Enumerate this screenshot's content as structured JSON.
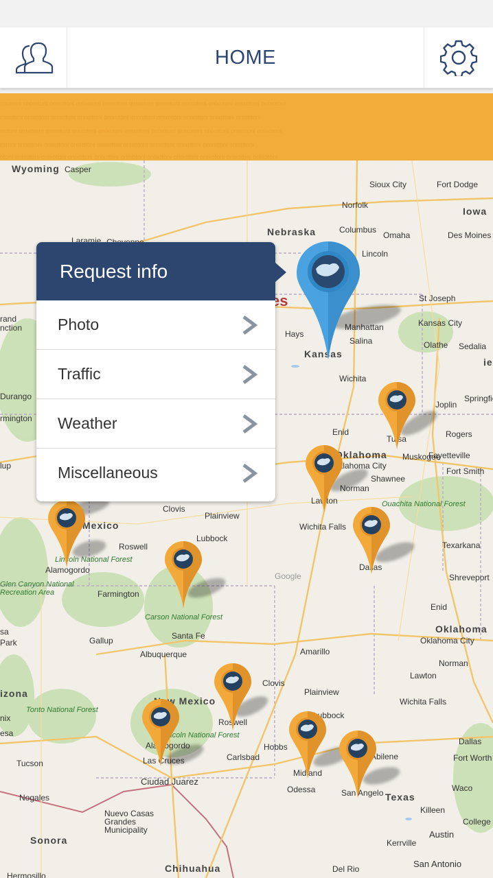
{
  "header": {
    "title": "HOME",
    "left_icon": "users-icon",
    "right_icon": "gear-icon"
  },
  "banner": {
    "color": "#f2ac3a",
    "pattern_text": "nixotoni"
  },
  "map": {
    "labels": {
      "wyoming": "Wyoming",
      "casper": "Casper",
      "nebraska": "Nebraska",
      "siouxcity": "Sioux City",
      "fortdodge": "Fort Dodge",
      "iowa": "Iowa",
      "norfolk": "Norfolk",
      "columbus": "Columbus",
      "omaha": "Omaha",
      "desmoines": "Des Moines",
      "lincoln": "Lincoln",
      "laramie": "Laramie",
      "cheyenne": "Cheyenne",
      "stjoseph": "St Joseph",
      "kansascity": "Kansas City",
      "manhattan": "Manhattan",
      "hays": "Hays",
      "salina": "Salina",
      "olathe": "Olathe",
      "sedalia": "Sedalia",
      "kansas": "Kansas",
      "wichita": "Wichita",
      "springfield": "Springfie",
      "joplin": "Joplin",
      "durango": "Durango",
      "farmington_top": "Farmington",
      "enid": "Enid",
      "tulsa": "Tulsa",
      "rogers": "Rogers",
      "oklahoma_top": "Oklahoma",
      "okcity_top": "Oklahoma City",
      "muskogee": "Muskogee",
      "fayetteville": "Fayetteville",
      "shawnee": "Shawnee",
      "fortsmith": "Fort Smith",
      "norman_top": "Norman",
      "lawton_top": "Lawton",
      "ouachita": "Ouachita National Forest",
      "clovis_top": "Clovis",
      "plainview_top": "Plainview",
      "mexico": "Mexico",
      "lubbock": "Lubbock",
      "wichitafalls": "Wichita Falls",
      "texarkana": "Texarkana",
      "roswell_top": "Roswell",
      "alamogordo_top": "Alamogordo",
      "lincolnforest_top": "Lincoln National Forest",
      "dallas_top": "Dallas",
      "shreveport": "Shreveport",
      "glencanyon": "Glen Canyon National Recreation Area",
      "farmington": "Farmington",
      "carson": "Carson National Forest",
      "enid2": "Enid",
      "oklahoma": "Oklahoma",
      "okcity": "Oklahoma City",
      "santafe": "Santa Fe",
      "gallup": "Gallup",
      "park": "Park",
      "amarillo": "Amarillo",
      "norman": "Norman",
      "albuquerque": "Albuquerque",
      "clovis": "Clovis",
      "lawton": "Lawton",
      "plainview": "Plainview",
      "wichitafalls2": "Wichita Falls",
      "arizona": "izona",
      "tonto": "Tonto National Forest",
      "newmexico": "New Mexico",
      "lubbock2": "Lubbock",
      "roswell": "Roswell",
      "nix": "nix",
      "esa": "esa",
      "lincolnforest": "Lincoln National Forest",
      "alamogordo": "Alamogordo",
      "hobbs": "Hobbs",
      "dallas": "Dallas",
      "fortworth": "Fort Worth",
      "tucson": "Tucson",
      "lascruces": "Las Cruces",
      "carlsbad": "Carlsbad",
      "midland": "Midland",
      "abilene": "Abilene",
      "ciudadjuarez": "Ciudad Juarez",
      "odessa": "Odessa",
      "waco": "Waco",
      "nogales": "Nogales",
      "sanangelo": "San Angelo",
      "texas": "Texas",
      "killeen": "Killeen",
      "nuevocasas": "Nuevo Casas Grandes Municipality",
      "collegestation": "College St",
      "sonora": "Sonora",
      "austin": "Austin",
      "kerrville": "Kerrville",
      "chihuahua": "Chihuahua",
      "sanantonio": "San Antonio",
      "hermosillo": "Hermosillo",
      "delrio": "Del Rio",
      "google": "Google",
      "states_fragment": "es",
      "grand": "rand",
      "unction": "nction",
      "rmington": "rmington",
      "lup": "lup",
      "sa": "sa",
      "ie": "ie"
    }
  },
  "popup": {
    "title": "Request info",
    "items": [
      {
        "label": "Photo"
      },
      {
        "label": "Traffic"
      },
      {
        "label": "Weather"
      },
      {
        "label": "Miscellaneous"
      }
    ]
  },
  "pins": {
    "selected_color": "#4aa3e0",
    "default_color": "#f2a93a"
  }
}
